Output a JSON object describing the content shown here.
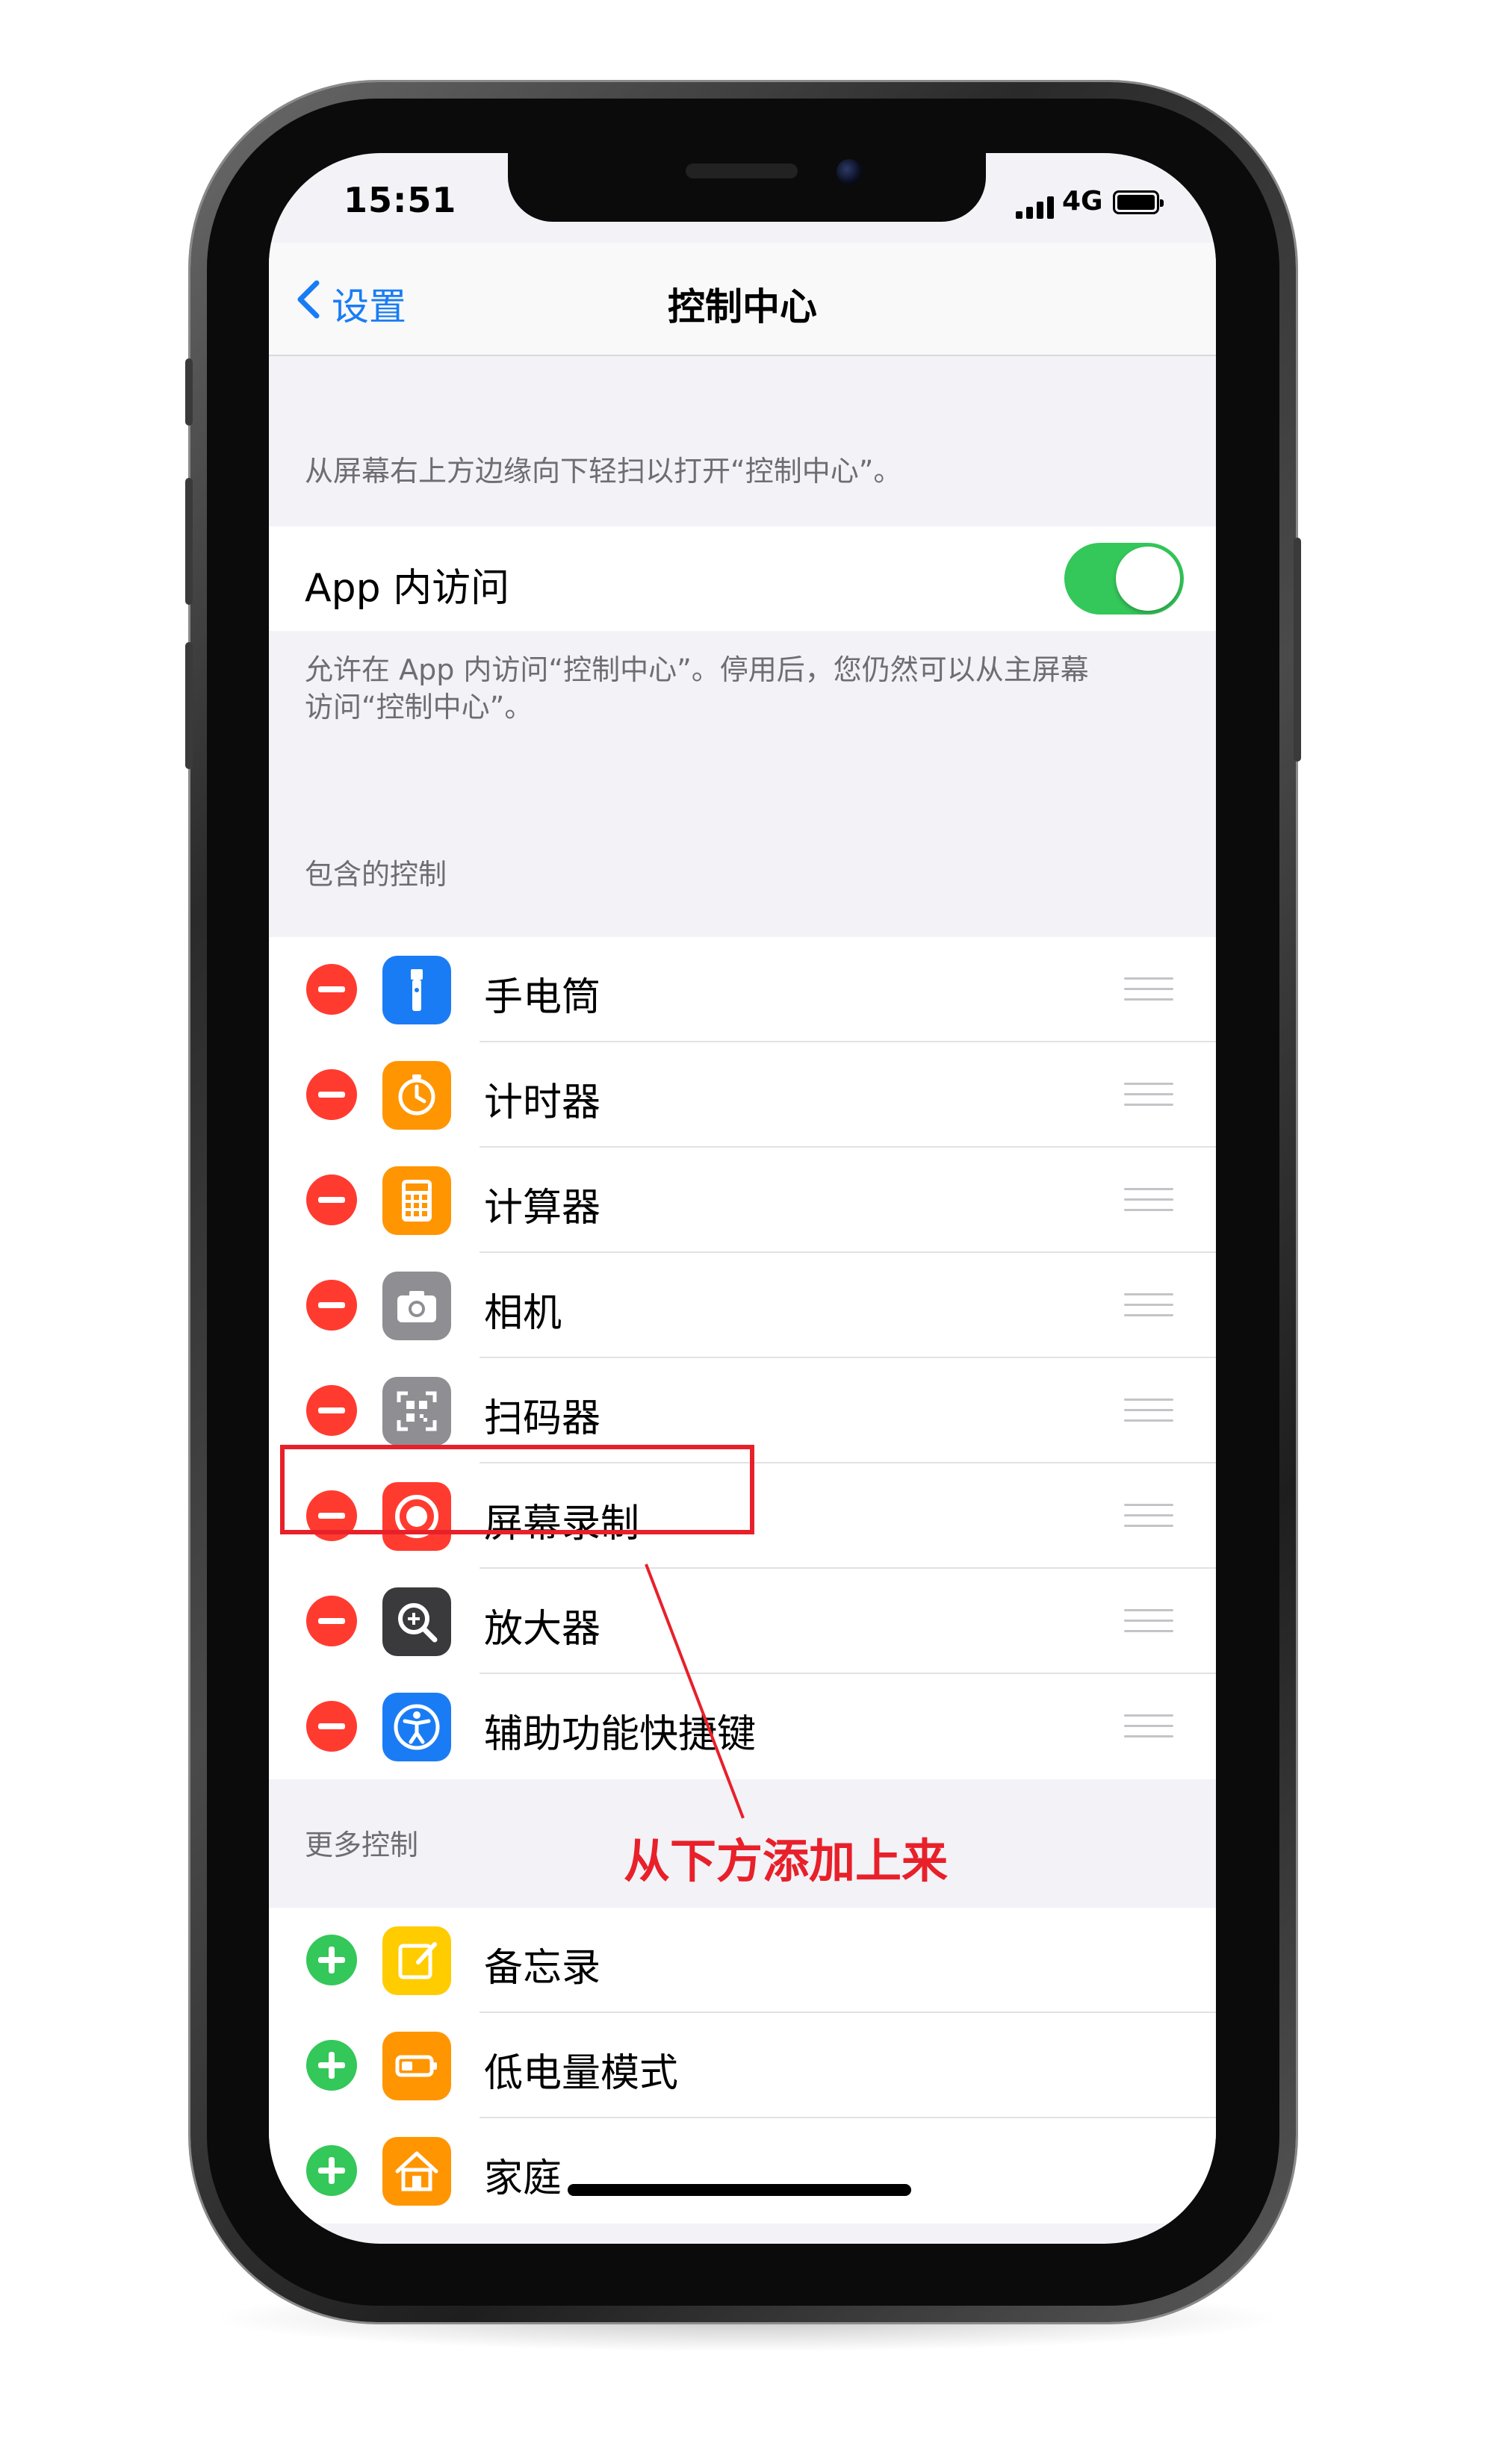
{
  "status_bar": {
    "time": "15:51",
    "network": "4G"
  },
  "nav": {
    "back_label": "设置",
    "title": "控制中心"
  },
  "intro_note": "从屏幕右上方边缘向下轻扫以打开“控制中心”。",
  "in_app_access": {
    "label": "App 内访问",
    "enabled": true,
    "note_line1": "允许在 App 内访问“控制中心”。停用后，您仍然可以从主屏幕",
    "note_line2": "访问“控制中心”。"
  },
  "included_controls": {
    "header": "包含的控制",
    "items": [
      {
        "label": "手电筒",
        "icon": "flashlight-icon",
        "color": "#1a7cf5"
      },
      {
        "label": "计时器",
        "icon": "timer-icon",
        "color": "#ff9500"
      },
      {
        "label": "计算器",
        "icon": "calculator-icon",
        "color": "#ff9500"
      },
      {
        "label": "相机",
        "icon": "camera-icon",
        "color": "#8e8e93"
      },
      {
        "label": "扫码器",
        "icon": "qr-scanner-icon",
        "color": "#8e8e93"
      },
      {
        "label": "屏幕录制",
        "icon": "screen-record-icon",
        "color": "#ff3b30"
      },
      {
        "label": "放大器",
        "icon": "magnifier-icon",
        "color": "#3a3a3c"
      },
      {
        "label": "辅助功能快捷键",
        "icon": "accessibility-icon",
        "color": "#1a7cf5"
      }
    ]
  },
  "more_controls": {
    "header": "更多控制",
    "items": [
      {
        "label": "备忘录",
        "icon": "notes-icon",
        "color": "#ffcc00"
      },
      {
        "label": "低电量模式",
        "icon": "low-power-icon",
        "color": "#ff9500"
      },
      {
        "label": "家庭",
        "icon": "home-icon",
        "color": "#ff9500"
      }
    ]
  },
  "annotation": {
    "text": "从下方添加上来",
    "color": "#e8202a"
  },
  "colors": {
    "accent": "#1a7cf5",
    "remove": "#ff3b30",
    "add": "#34c759"
  }
}
